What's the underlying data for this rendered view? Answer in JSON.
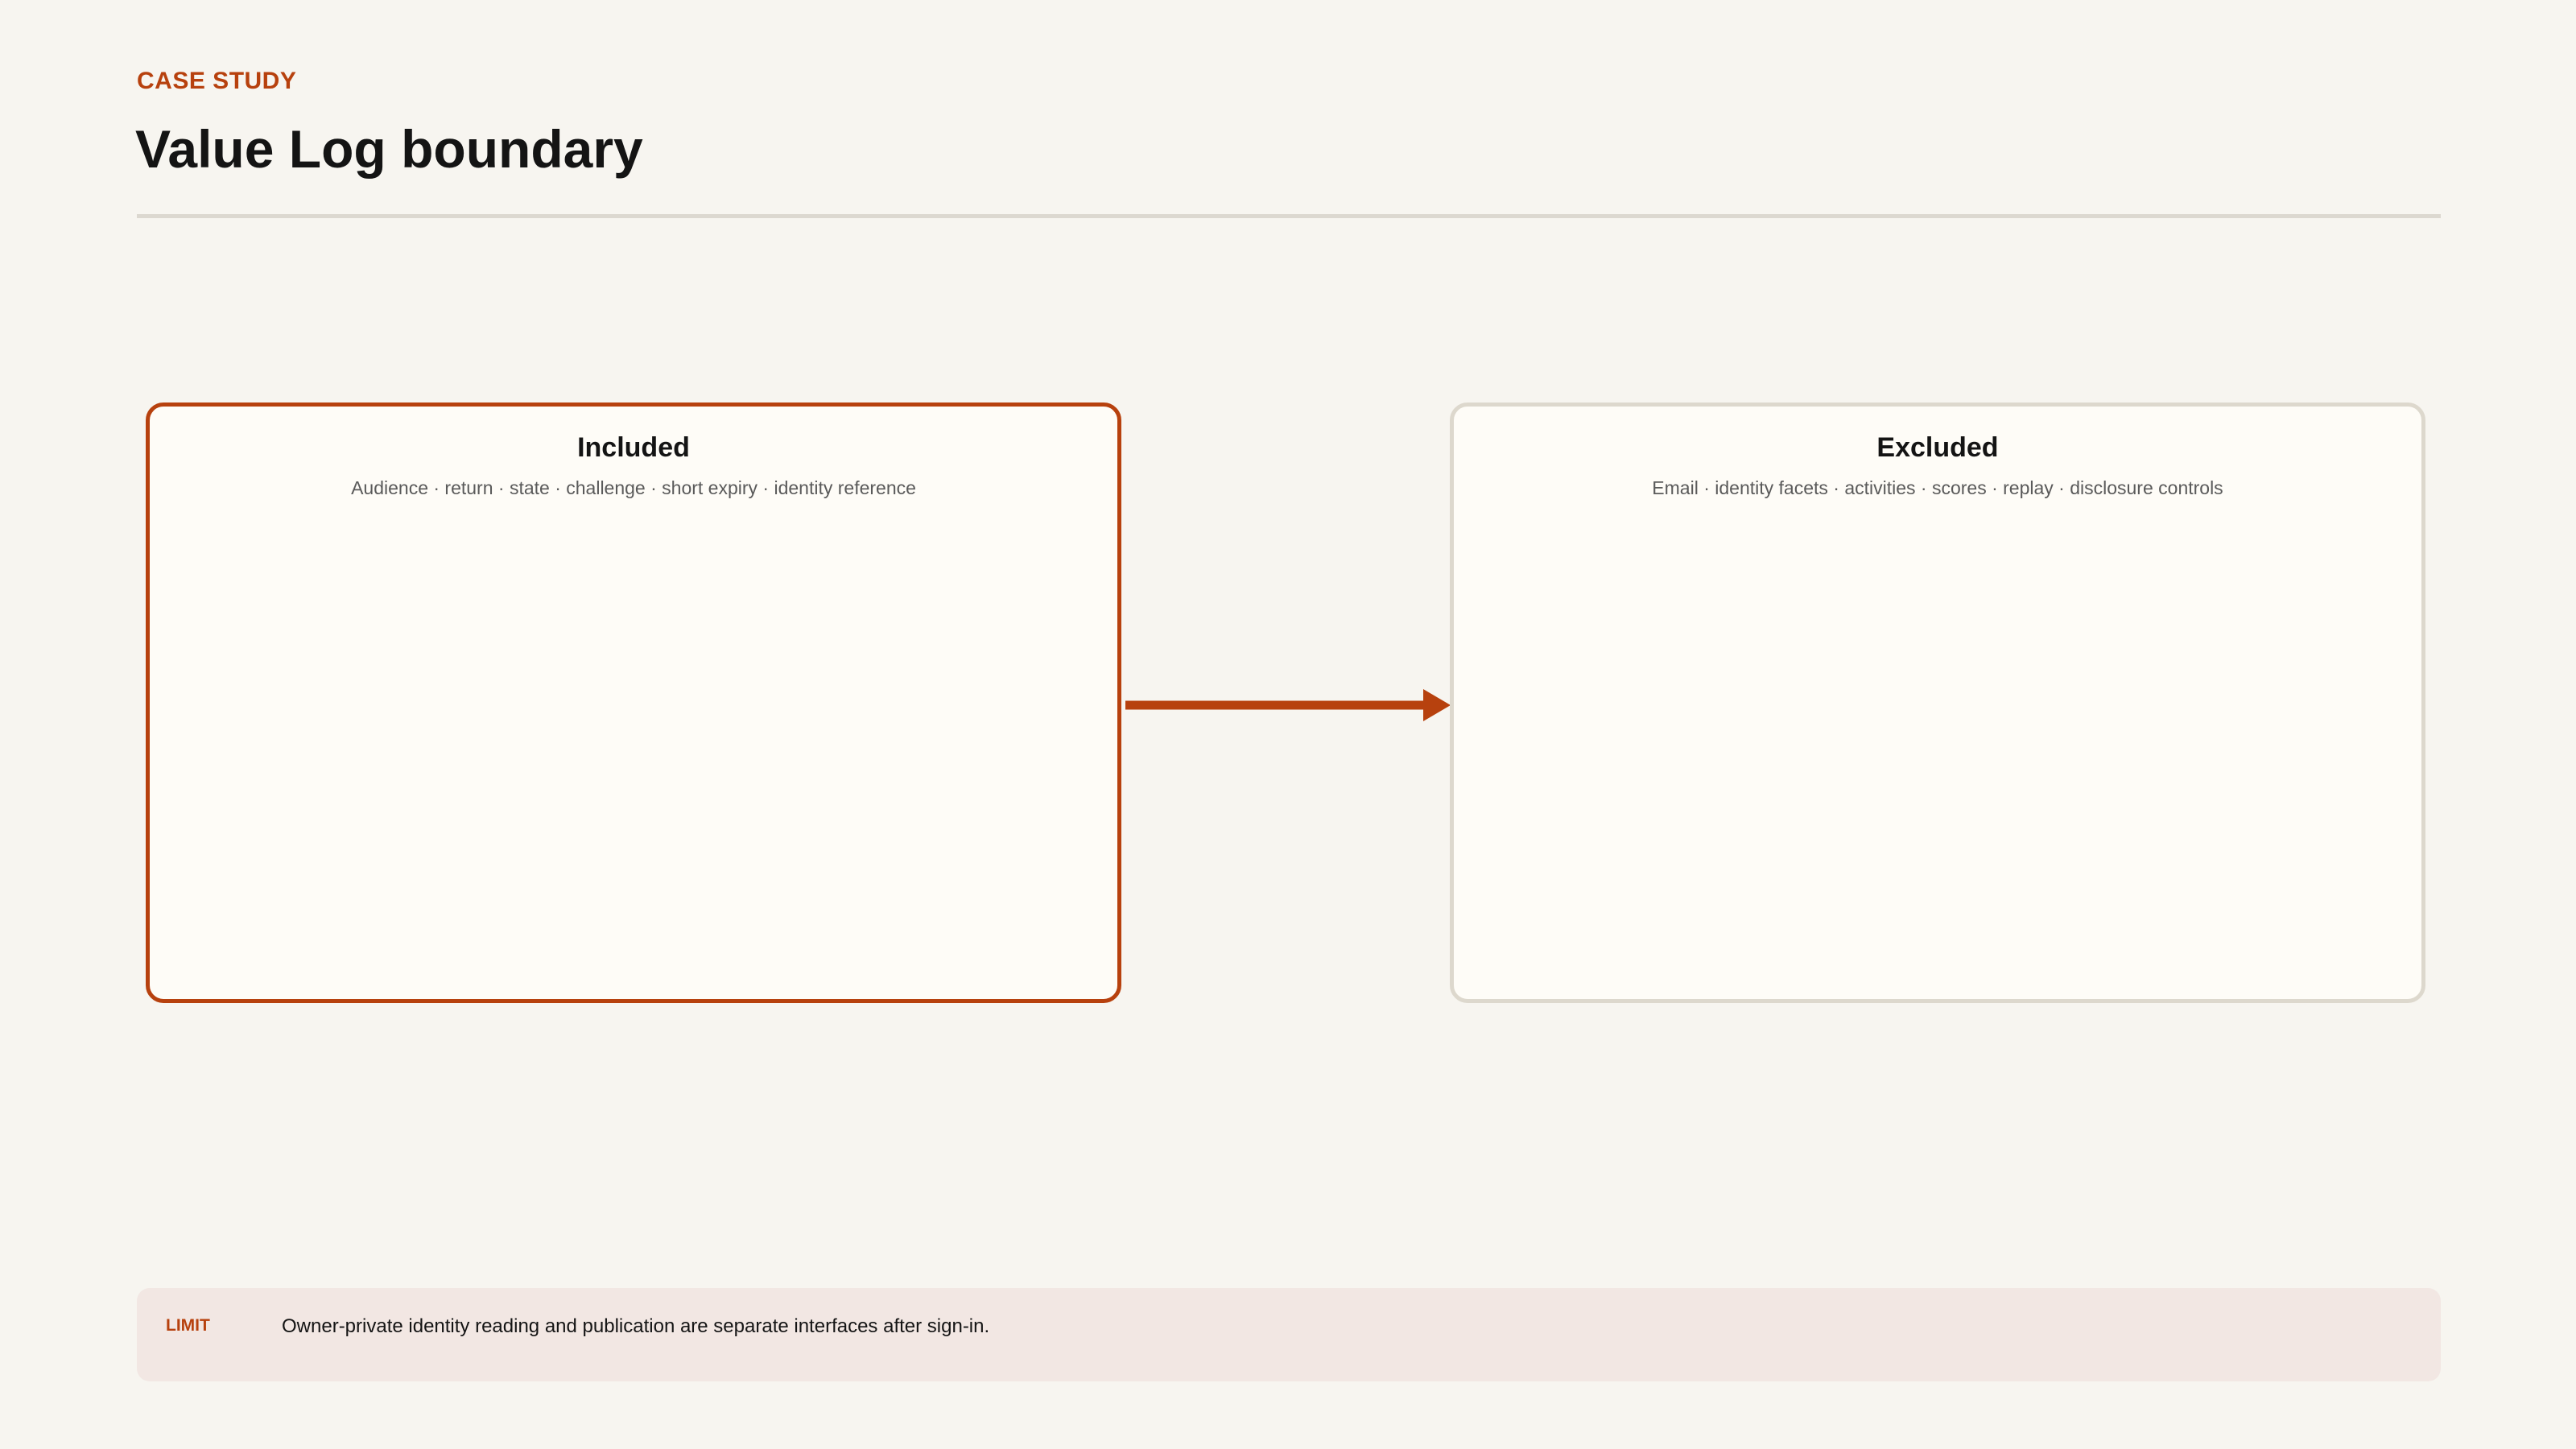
{
  "header": {
    "eyebrow": "CASE STUDY",
    "title": "Value Log boundary"
  },
  "diagram": {
    "included": {
      "title": "Included",
      "items": "Audience · return · state · challenge · short expiry · identity reference"
    },
    "excluded": {
      "title": "Excluded",
      "items": "Email · identity facets · activities · scores · replay · disclosure controls"
    },
    "arrow": {
      "from": "Included",
      "to": "Excluded"
    }
  },
  "limit": {
    "label": "LIMIT",
    "text": "Owner-private identity reading and publication are separate interfaces after sign-in."
  },
  "colors": {
    "accent": "#b7410e",
    "background": "#f7f5f0",
    "box_fill": "#fefcf7",
    "box_border_neutral": "#ddd8cd",
    "limit_fill": "#f2e7e3"
  }
}
